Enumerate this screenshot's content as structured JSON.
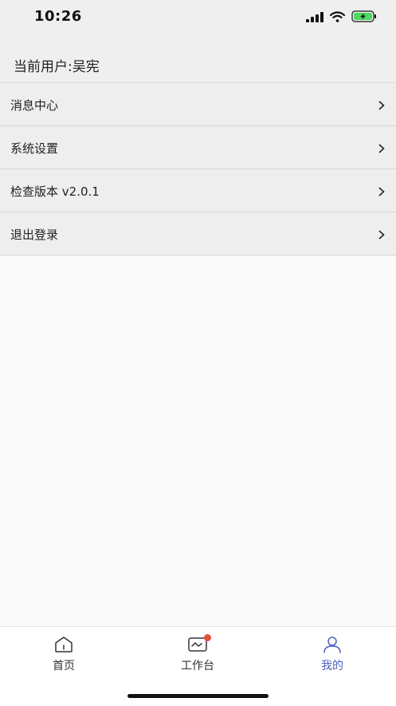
{
  "status_bar": {
    "time": "10:26",
    "icons": [
      "signal-icon",
      "wifi-icon",
      "battery-charging-icon"
    ]
  },
  "header": {
    "current_user": "当前用户:吴宪"
  },
  "menu": {
    "items": [
      {
        "label": "消息中心",
        "icon": "chevron-right-icon"
      },
      {
        "label": "系统设置",
        "icon": "chevron-right-icon"
      },
      {
        "label": "检查版本 v2.0.1",
        "icon": "chevron-right-icon"
      },
      {
        "label": "退出登录",
        "icon": "chevron-right-icon"
      }
    ]
  },
  "tabbar": {
    "tabs": [
      {
        "label": "首页",
        "icon": "home-icon",
        "active": false
      },
      {
        "label": "工作台",
        "icon": "workbench-icon",
        "active": false,
        "badge": true
      },
      {
        "label": "我的",
        "icon": "user-icon",
        "active": true
      }
    ]
  },
  "colors": {
    "accent": "#4a5fc1",
    "badge": "#e5503c",
    "battery": "#4cd964"
  }
}
